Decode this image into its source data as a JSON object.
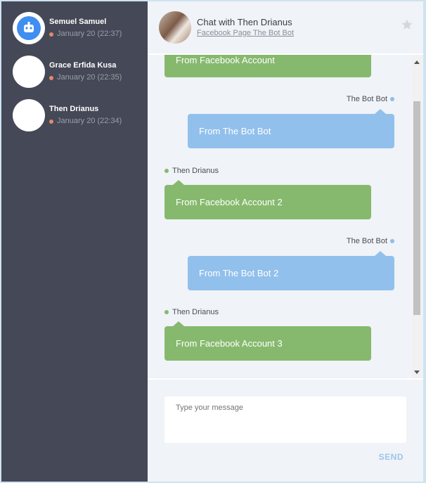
{
  "sidebar": {
    "contacts": [
      {
        "name": "Semuel Samuel",
        "time": "January 20 (22:37)"
      },
      {
        "name": "Grace Erfida Kusa",
        "time": "January 20 (22:35)"
      },
      {
        "name": "Then Drianus",
        "time": "January 20 (22:34)"
      }
    ]
  },
  "header": {
    "title": "Chat with Then Drianus",
    "subtitle": "Facebook Page The Bot Bot",
    "star_icon": "star-icon"
  },
  "messages": [
    {
      "sender": "",
      "text": "From Facebook Account",
      "side": "left"
    },
    {
      "sender": "The Bot Bot",
      "text": "From The Bot Bot",
      "side": "right"
    },
    {
      "sender": "Then Drianus",
      "text": "From Facebook Account 2",
      "side": "left"
    },
    {
      "sender": "The Bot Bot",
      "text": "From The Bot Bot 2",
      "side": "right"
    },
    {
      "sender": "Then Drianus",
      "text": "From Facebook Account 3",
      "side": "left"
    }
  ],
  "composer": {
    "placeholder": "Type your message",
    "send_label": "SEND"
  },
  "colors": {
    "sidebar_bg": "#454856",
    "incoming_bubble": "#86b96e",
    "outgoing_bubble": "#92c0ec",
    "status_dot": "#e08a6a"
  }
}
